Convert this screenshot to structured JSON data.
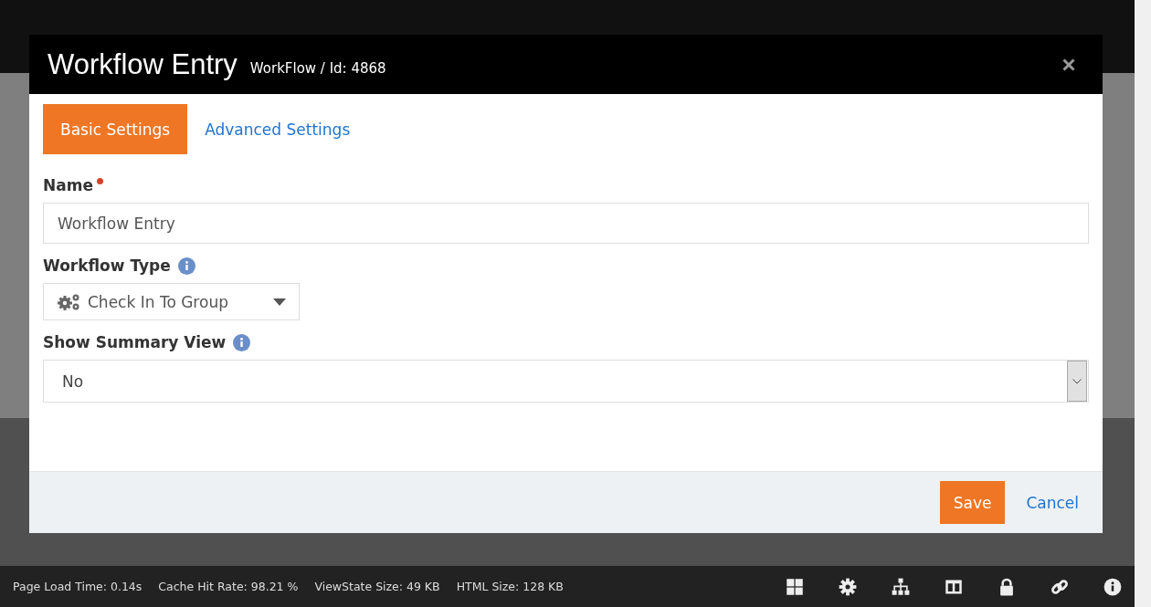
{
  "modal": {
    "title": "Workflow Entry",
    "subtitle": "WorkFlow / Id: 4868",
    "tabs": [
      {
        "label": "Basic Settings",
        "selected": true
      },
      {
        "label": "Advanced Settings",
        "selected": false
      }
    ],
    "fields": [
      {
        "kind": "text",
        "label": "Name",
        "required": true,
        "info": false,
        "value": "Workflow Entry"
      },
      {
        "kind": "picker",
        "label": "Workflow Type",
        "required": false,
        "info": true,
        "value": "Check In To Group"
      },
      {
        "kind": "select",
        "label": "Show Summary View",
        "required": false,
        "info": true,
        "value": "No"
      }
    ],
    "buttons": [
      {
        "kind": "primary",
        "label": "Save"
      },
      {
        "kind": "link",
        "label": "Cancel"
      }
    ]
  },
  "status_bar": {
    "stats": [
      "Page Load Time: 0.14s",
      "Cache Hit Rate: 98.21 %",
      "ViewState Size: 49 KB",
      "HTML Size: 128 KB"
    ]
  }
}
